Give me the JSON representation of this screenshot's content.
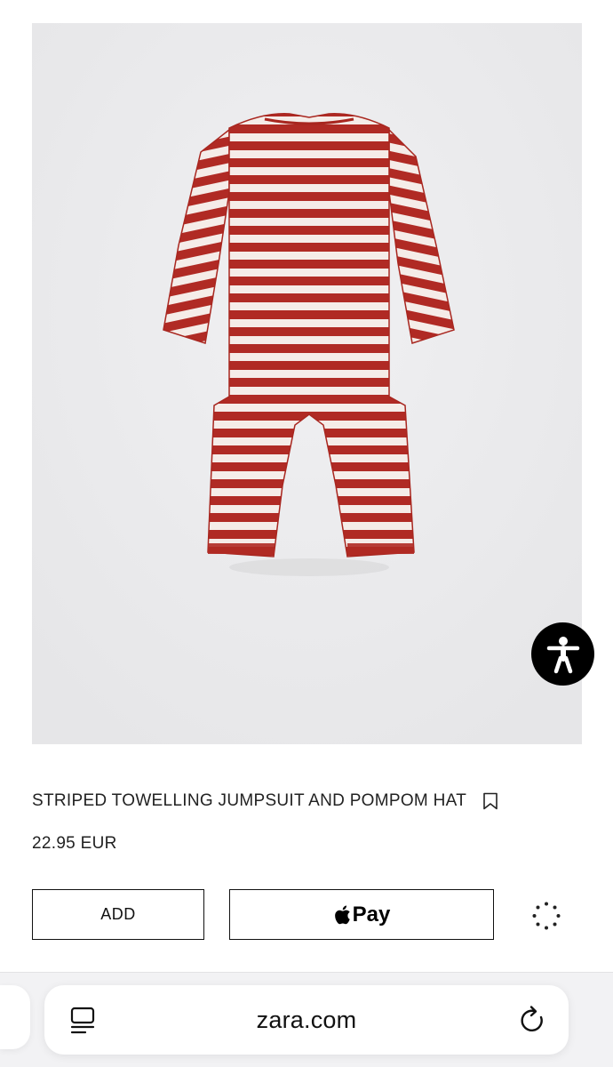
{
  "product": {
    "image_icon": "striped-jumpsuit-photo",
    "title": "STRIPED TOWELLING JUMPSUIT AND POMPOM HAT",
    "price": "22.95 EUR",
    "stripe_color": "#b02a24",
    "stripe_light": "#f5ece8"
  },
  "actions": {
    "add_label": "ADD",
    "pay_label": "Pay",
    "pay_icon": "apple-logo-icon",
    "loading_icon": "loading-spinner-icon",
    "bookmark_icon": "bookmark-icon",
    "accessibility_icon": "accessibility-icon"
  },
  "browser": {
    "url": "zara.com",
    "tabs_icon": "tab-overview-icon",
    "reload_icon": "reload-icon"
  }
}
